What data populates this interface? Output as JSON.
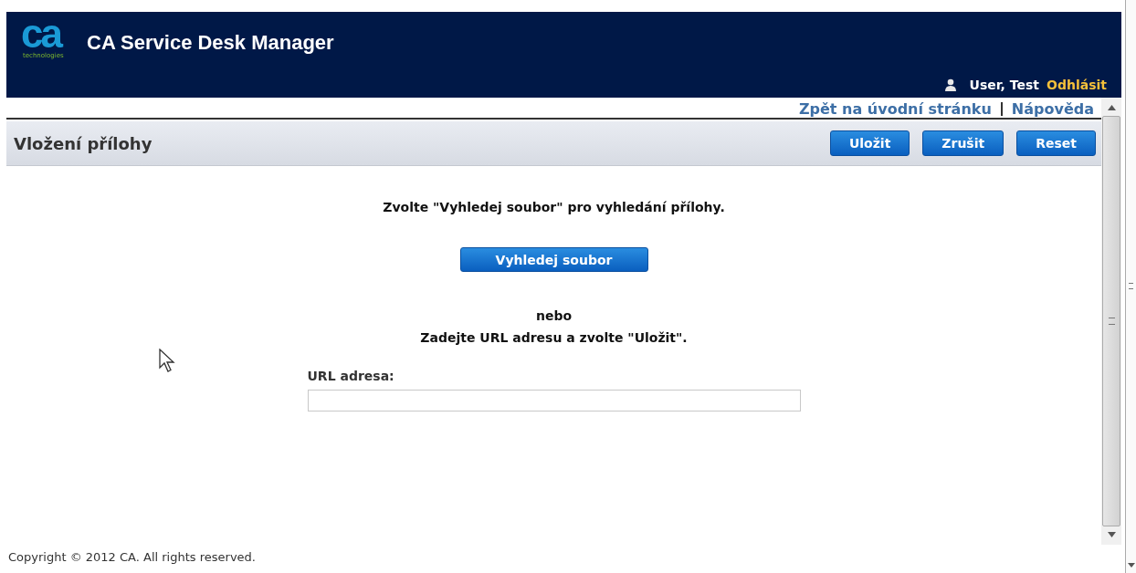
{
  "header": {
    "logo": {
      "mark": "ca",
      "tagline": "technologies"
    },
    "title": "CA Service Desk Manager",
    "user": "User, Test",
    "logout": "Odhlásit"
  },
  "nav_links": [
    "Zpět na úvodní stránku",
    "Nápověda"
  ],
  "page": {
    "title": "Vložení přílohy",
    "buttons": [
      "Uložit",
      "Zrušit",
      "Reset"
    ]
  },
  "form": {
    "instruction": "Zvolte \"Vyhledej soubor\" pro vyhledání přílohy.",
    "browse_button": "Vyhledej soubor",
    "or": "nebo",
    "url_instruction": "Zadejte URL adresu a zvolte \"Uložit\".",
    "url_label": "URL adresa:"
  },
  "footer": "Copyright © 2012 CA. All rights reserved."
}
